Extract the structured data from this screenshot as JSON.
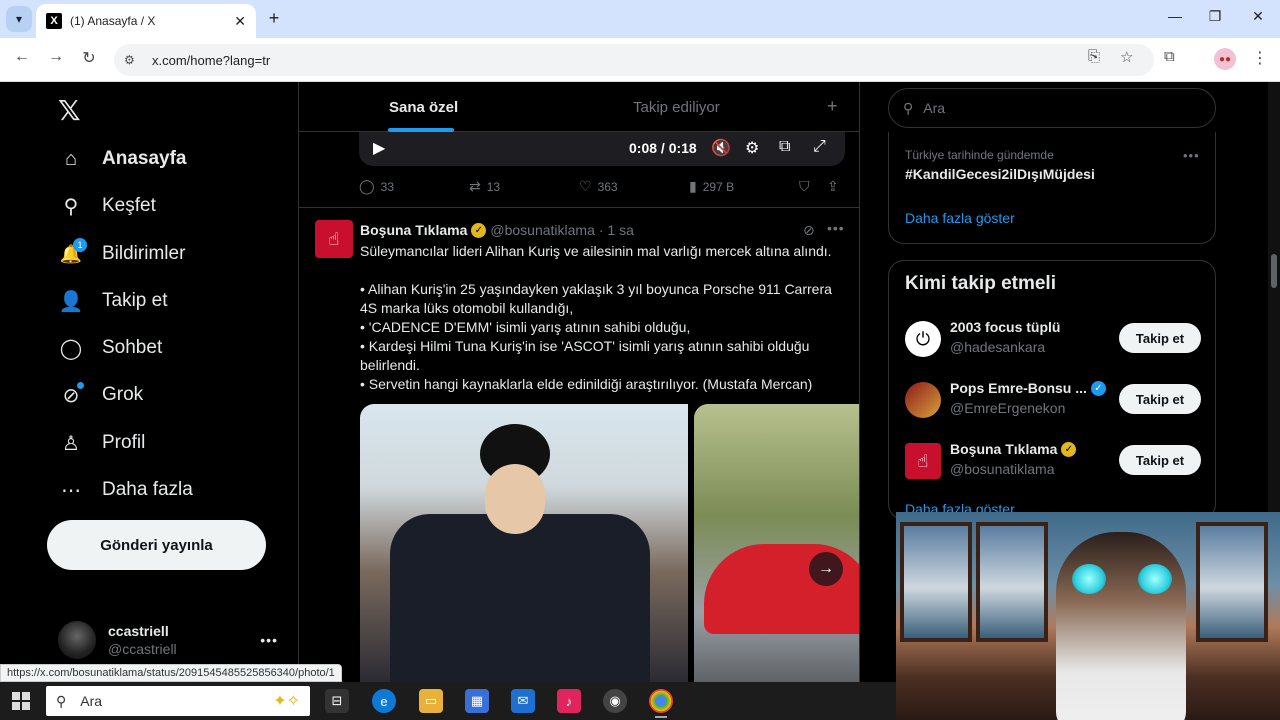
{
  "browser": {
    "tab_title": "(1) Anasayfa / X",
    "tab_close": "✕",
    "new_tab": "+",
    "url": "x.com/home?lang=tr",
    "status_url": "https://x.com/bosunatiklama/status/2091545485525856340/photo/1"
  },
  "sidebar": {
    "logo": "𝕏",
    "items": [
      {
        "label": "Anasayfa",
        "icon": "home-icon",
        "glyph": "⌂"
      },
      {
        "label": "Keşfet",
        "icon": "search-icon",
        "glyph": "⚲"
      },
      {
        "label": "Bildirimler",
        "icon": "bell-icon",
        "glyph": "🔔",
        "badge": "1"
      },
      {
        "label": "Takip et",
        "icon": "follow-icon",
        "glyph": "👤"
      },
      {
        "label": "Sohbet",
        "icon": "chat-icon",
        "glyph": "◯"
      },
      {
        "label": "Grok",
        "icon": "grok-icon",
        "glyph": "⊘"
      },
      {
        "label": "Profil",
        "icon": "profile-icon",
        "glyph": "♙"
      },
      {
        "label": "Daha fazla",
        "icon": "more-icon",
        "glyph": "⋯"
      }
    ],
    "post_button": "Gönderi yayınla",
    "account": {
      "name": "ccastriell",
      "handle": "@ccastriell",
      "more": "•••"
    }
  },
  "feed": {
    "tabs": [
      {
        "label": "Sana özel"
      },
      {
        "label": "Takip ediliyor"
      }
    ],
    "add": "+",
    "video": {
      "time": "0:08 / 0:18"
    },
    "prev_actions": {
      "replies": "33",
      "reposts": "13",
      "likes": "363",
      "views": "297 B"
    },
    "tweet": {
      "name": "Boşuna Tıklama",
      "handle": "@bosunatiklama",
      "time": "· 1 sa",
      "more": "•••",
      "lines": [
        "Süleymancılar lideri Alihan Kuriş ve ailesinin mal varlığı mercek altına alındı.",
        "",
        "• Alihan Kuriş'in 25 yaşındayken yaklaşık 3 yıl boyunca Porsche 911 Carrera 4S marka lüks otomobil kullandığı,",
        "• 'CADENCE D'EMM' isimli yarış atının sahibi olduğu,",
        "• Kardeşi Hilmi Tuna Kuriş'in ise 'ASCOT' isimli yarış atının sahibi olduğu belirlendi.",
        "• Servetin hangi kaynaklarla elde edinildiği araştırılıyor. (Mustafa Mercan)"
      ]
    }
  },
  "right": {
    "search_placeholder": "Ara",
    "trend": {
      "context": "Türkiye tarihinde gündemde",
      "tag": "#KandilGecesi2ilDışıMüjdesi",
      "more": "•••",
      "show_more": "Daha fazla göster"
    },
    "who_to_follow": {
      "title": "Kimi takip etmeli",
      "follow_label": "Takip et",
      "users": [
        {
          "name": "2003 focus tüplü",
          "handle": "@hadesankara"
        },
        {
          "name": "Pops Emre-Bonsu ...",
          "handle": "@EmreErgenekon"
        },
        {
          "name": "Boşuna Tıklama",
          "handle": "@bosunatiklama"
        }
      ],
      "show_more": "Daha fazla göster"
    }
  },
  "taskbar": {
    "search_placeholder": "Ara"
  }
}
